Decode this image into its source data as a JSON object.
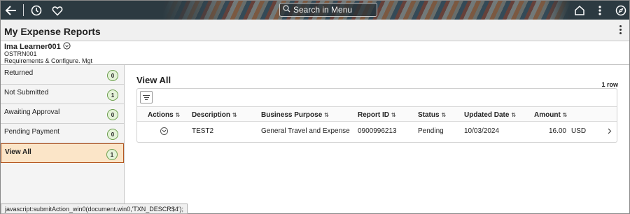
{
  "topbar": {
    "search_placeholder": "Search in Menu",
    "icons": [
      "back-arrow-icon",
      "history-clock-icon",
      "favorites-heart-icon",
      "search-icon",
      "home-icon",
      "more-vertical-icon",
      "navbar-compass-icon"
    ]
  },
  "page": {
    "title": "My Expense Reports"
  },
  "user": {
    "name": "Ima Learner001",
    "id": "OSTRN001",
    "department": "Requirements & Configure. Mgt"
  },
  "sidebar": {
    "items": [
      {
        "label": "Returned",
        "count": "0"
      },
      {
        "label": "Not Submitted",
        "count": "1"
      },
      {
        "label": "Awaiting Approval",
        "count": "0"
      },
      {
        "label": "Pending Payment",
        "count": "0"
      },
      {
        "label": "View All",
        "count": "1"
      }
    ],
    "active_index": 4
  },
  "main": {
    "title": "View All",
    "row_count": "1 row",
    "columns": [
      "Actions",
      "Description",
      "Business Purpose",
      "Report ID",
      "Status",
      "Updated Date",
      "Amount"
    ],
    "rows": [
      {
        "description": "TEST2",
        "business_purpose": "General Travel and Expense",
        "report_id": "0900996213",
        "status": "Pending",
        "updated_date": "10/03/2024",
        "amount": "16.00",
        "currency": "USD"
      }
    ]
  },
  "statusbar": {
    "text": "javascript:submitAction_win0(document.win0,'TXN_DESCR$4');"
  },
  "colors": {
    "active_bg": "#fbe5c8",
    "active_border": "#b3541e",
    "badge_bg": "#e4f2d8",
    "badge_border": "#6b9f4b"
  }
}
